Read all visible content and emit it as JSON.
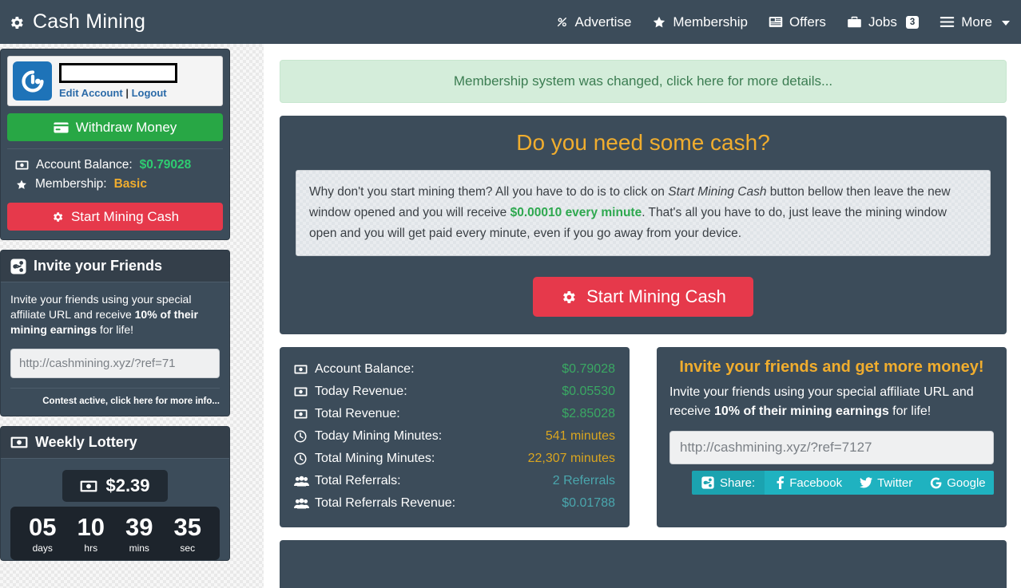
{
  "navbar": {
    "brand": "Cash Mining",
    "brand_icon": "gear-icon",
    "items": [
      {
        "label": "Advertise",
        "icon": "link-icon"
      },
      {
        "label": "Membership",
        "icon": "star-icon"
      },
      {
        "label": "Offers",
        "icon": "list-icon"
      },
      {
        "label": "Jobs",
        "icon": "briefcase-icon",
        "badge": "3"
      },
      {
        "label": "More",
        "icon": "hamburger-icon",
        "caret": true
      }
    ]
  },
  "sidebar": {
    "account": {
      "avatar_icon": "gravatar-logo-icon",
      "username_redacted": "",
      "edit_label": "Edit Account",
      "separator": "|",
      "logout_label": "Logout"
    },
    "withdraw_button": {
      "label": "Withdraw Money",
      "icon": "credit-card-icon"
    },
    "stats": [
      {
        "icon": "money-bill-icon",
        "label": "Account Balance:",
        "value": "$0.79028",
        "value_color": "#2ecc71"
      },
      {
        "icon": "star-icon",
        "label": "Membership:",
        "value": "Basic",
        "value_color": "#f0ad2e"
      }
    ],
    "mining_button": {
      "label": "Start Mining Cash",
      "icon": "gear-icon"
    },
    "invite_panel": {
      "title": "Invite your Friends",
      "icon": "share-icon",
      "text_prefix": "Invite your friends using your special affiliate URL and receive ",
      "text_bold": "10% of their mining earnings",
      "text_suffix": " for life!",
      "ref_url": "http://cashmining.xyz/?ref=71",
      "contest_link": "Contest active, click here for more info..."
    },
    "lottery_panel": {
      "title": "Weekly Lottery",
      "icon": "money-bill-icon",
      "amount": "$2.39",
      "amount_icon": "money-bill-icon",
      "countdown": [
        {
          "value": "05",
          "unit": "days"
        },
        {
          "value": "10",
          "unit": "hrs"
        },
        {
          "value": "39",
          "unit": "mins"
        },
        {
          "value": "35",
          "unit": "sec"
        }
      ]
    }
  },
  "main": {
    "alert": "Membership system was changed, click here for more details...",
    "cash_card": {
      "title": "Do you need some cash?",
      "body_1": "Why don't you start mining them? All you have to do is to click on ",
      "body_em": "Start Mining Cash",
      "body_2": " button bellow then leave the new window opened and you will receive ",
      "body_rate": "$0.00010 every minute",
      "body_3": ". That's all you have to do, just leave the mining window open and you will get paid every minute, even if you go away from your device.",
      "cta_label": "Start Mining Cash",
      "cta_icon": "gear-icon"
    },
    "stats": [
      {
        "icon": "money-bill-icon",
        "label": "Account Balance:",
        "value": "$0.79028",
        "color": "#3aa863"
      },
      {
        "icon": "money-bill-icon",
        "label": "Today Revenue:",
        "value": "$0.05530",
        "color": "#3aa863"
      },
      {
        "icon": "money-bill-icon",
        "label": "Total Revenue:",
        "value": "$2.85028",
        "color": "#3aa863"
      },
      {
        "icon": "clock-icon",
        "label": "Today Mining Minutes:",
        "value": "541 minutes",
        "color": "#d9a520"
      },
      {
        "icon": "clock-icon",
        "label": "Total Mining Minutes:",
        "value": "22,307 minutes",
        "color": "#d9a520"
      },
      {
        "icon": "users-icon",
        "label": "Total Referrals:",
        "value": "2 Referrals",
        "color": "#4aa6ad"
      },
      {
        "icon": "users-icon",
        "label": "Total Referrals Revenue:",
        "value": "$0.01788",
        "color": "#4aa6ad"
      }
    ],
    "invite_card": {
      "title": "Invite your friends and get more money!",
      "text_prefix": "Invite your friends using your special affiliate URL and receive ",
      "text_bold": "10% of their mining earnings",
      "text_suffix": " for life!",
      "ref_url": "http://cashmining.xyz/?ref=7127",
      "share_label": "Share:",
      "share_icon": "share-icon",
      "share_links": [
        {
          "label": "Facebook",
          "icon": "facebook-icon"
        },
        {
          "label": "Twitter",
          "icon": "twitter-icon"
        },
        {
          "label": "Google",
          "icon": "google-icon"
        }
      ]
    }
  },
  "colors": {
    "nav_bg": "#3c4c5a",
    "panel_bg": "#3c4c5a",
    "accent_gold": "#f0ad2e",
    "accent_red": "#e6394b",
    "accent_green": "#28a745",
    "accent_teal": "#1fb2c0"
  }
}
